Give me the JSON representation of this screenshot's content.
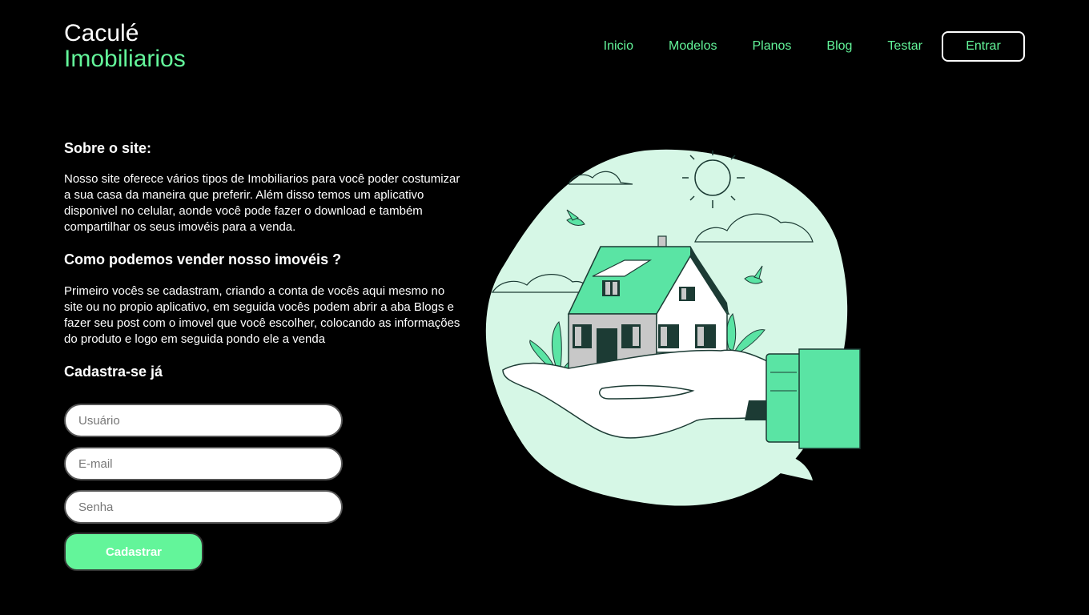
{
  "brand": {
    "line1": "Caculé",
    "line2": "Imobiliarios"
  },
  "nav": {
    "items": [
      "Inicio",
      "Modelos",
      "Planos",
      "Blog",
      "Testar"
    ],
    "login_label": "Entrar"
  },
  "about": {
    "heading": "Sobre o site:",
    "text": "Nosso site oferece vários tipos de Imobiliarios para você poder costumizar a sua casa da maneira que preferir. Além disso temos um aplicativo disponivel no celular, aonde você pode fazer o download e também compartilhar os seus imovéis para a venda."
  },
  "howto": {
    "heading": "Como podemos vender nosso imovéis ?",
    "text": "Primeiro vocês se cadastram, criando a conta de vocês aqui mesmo no site ou no propio aplicativo, em seguida vocês podem abrir a aba Blogs e fazer seu post com o imovel que você escolher, colocando as informações do produto e logo em seguida pondo ele a venda"
  },
  "signup": {
    "heading": "Cadastra-se já",
    "username_placeholder": "Usuário",
    "email_placeholder": "E-mail",
    "password_placeholder": "Senha",
    "submit_label": "Cadastrar"
  },
  "colors": {
    "accent": "#63f59a",
    "illustration_bg": "#d6f7e6",
    "illustration_green": "#5ae4a4"
  }
}
